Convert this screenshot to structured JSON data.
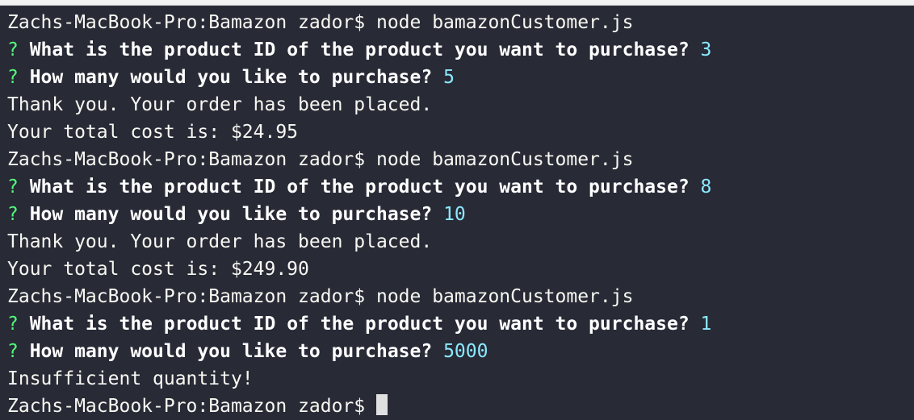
{
  "terminal": {
    "lines": [
      {
        "type": "command",
        "prompt": "Zachs-MacBook-Pro:Bamazon zador$ ",
        "command": "node bamazonCustomer.js"
      },
      {
        "type": "question",
        "mark": "? ",
        "question": "What is the product ID of the product you want to purchase? ",
        "answer": "3"
      },
      {
        "type": "question",
        "mark": "? ",
        "question": "How many would you like to purchase? ",
        "answer": "5"
      },
      {
        "type": "output",
        "text": "Thank you. Your order has been placed."
      },
      {
        "type": "output",
        "text": "Your total cost is: $24.95"
      },
      {
        "type": "command",
        "prompt": "Zachs-MacBook-Pro:Bamazon zador$ ",
        "command": "node bamazonCustomer.js"
      },
      {
        "type": "question",
        "mark": "? ",
        "question": "What is the product ID of the product you want to purchase? ",
        "answer": "8"
      },
      {
        "type": "question",
        "mark": "? ",
        "question": "How many would you like to purchase? ",
        "answer": "10"
      },
      {
        "type": "output",
        "text": "Thank you. Your order has been placed."
      },
      {
        "type": "output",
        "text": "Your total cost is: $249.90"
      },
      {
        "type": "command",
        "prompt": "Zachs-MacBook-Pro:Bamazon zador$ ",
        "command": "node bamazonCustomer.js"
      },
      {
        "type": "question",
        "mark": "? ",
        "question": "What is the product ID of the product you want to purchase? ",
        "answer": "1"
      },
      {
        "type": "question",
        "mark": "? ",
        "question": "How many would you like to purchase? ",
        "answer": "5000"
      },
      {
        "type": "output",
        "text": "Insufficient quantity!"
      },
      {
        "type": "command",
        "prompt": "Zachs-MacBook-Pro:Bamazon zador$ ",
        "command": ""
      }
    ]
  },
  "colors": {
    "background": "#282a36",
    "text": "#f8f8f2",
    "question_mark": "#50fa7b",
    "answer": "#8be9fd"
  }
}
